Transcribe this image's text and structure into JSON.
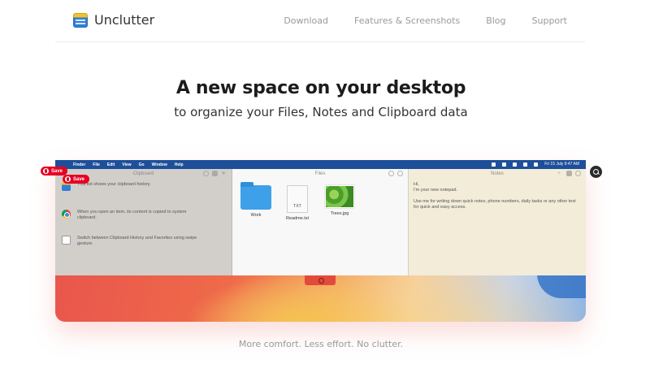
{
  "header": {
    "brand": "Unclutter",
    "nav": [
      "Download",
      "Features & Screenshots",
      "Blog",
      "Support"
    ]
  },
  "hero": {
    "title": "A new space on your desktop",
    "subtitle": "to organize your Files, Notes and Clipboard data"
  },
  "screenshot": {
    "menubar": {
      "items": [
        "Finder",
        "File",
        "Edit",
        "View",
        "Go",
        "Window",
        "Help"
      ],
      "clock": "Fri 15 July  9:47 AM"
    },
    "clipboard": {
      "title": "Clipboard",
      "rows": [
        "This list shows your clipboard history.",
        "When you open an item, its content is copied to system clipboard.",
        "Switch between Clipboard History and Favorites using swipe gesture."
      ]
    },
    "files": {
      "title": "Files",
      "items": [
        {
          "name": "Work",
          "icon": "folder-icon"
        },
        {
          "name": "Readme.txt",
          "icon": "text-file-icon",
          "badge": "TXT"
        },
        {
          "name": "Trees.jpg",
          "icon": "image-file-icon"
        }
      ]
    },
    "notes": {
      "title": "Notes",
      "line1": "Hi,",
      "line2": "I'm your new notepad.",
      "line3": "Use me for writing down quick notes, phone numbers, daily tasks or any other text for quick and easy access."
    }
  },
  "pins": [
    "Save",
    "Save"
  ],
  "tagline": "More comfort.  Less effort.  No clutter.",
  "colors": {
    "menubar": "#1d4f9a",
    "pin": "#e60023"
  }
}
